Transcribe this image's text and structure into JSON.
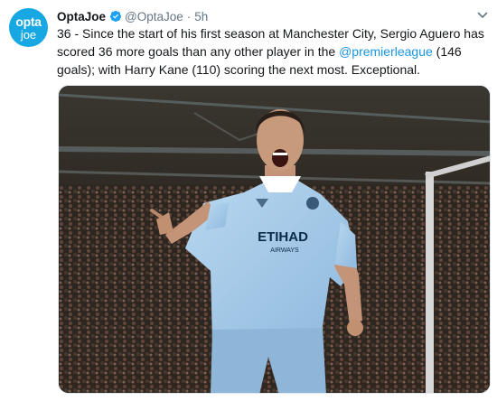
{
  "account": {
    "avatar_line1": "opta",
    "avatar_line2": "joe",
    "name": "OptaJoe",
    "handle": "@OptaJoe",
    "separator": "·",
    "time": "5h"
  },
  "tweet": {
    "text_before": "36 - Since the start of his first season at Manchester City, Sergio Aguero has scored 36 more goals than any other player in the ",
    "mention": "@premierleague",
    "text_after": " (146 goals); with Harry Kane (110) scoring the next most. Exceptional."
  },
  "media": {
    "shirt_sponsor": "ETIHAD",
    "shirt_sponsor_sub": "AIRWAYS",
    "image_icon": "photo-player-celebrating"
  },
  "icons": {
    "verified": "verified-badge-icon",
    "menu": "chevron-down-icon"
  },
  "colors": {
    "brand_blue": "#17a8e3",
    "link": "#1b95e0",
    "secondary_text": "#657786",
    "shirt_sky_blue": "#a9cdea"
  }
}
